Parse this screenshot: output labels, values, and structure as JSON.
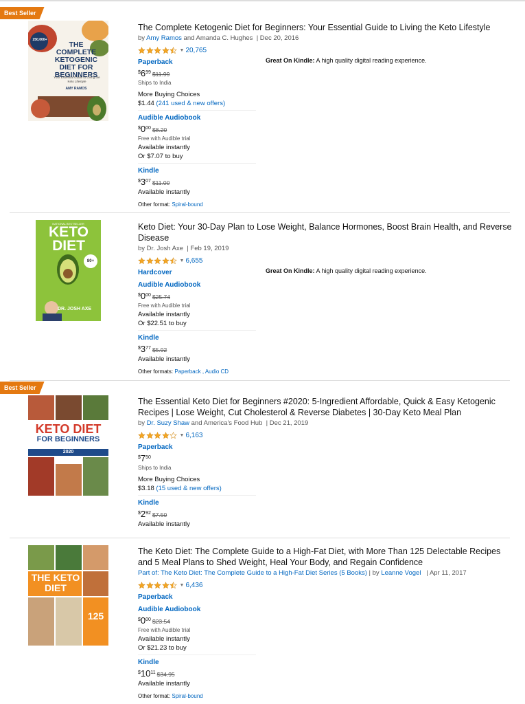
{
  "badge_label": "Best Seller",
  "kindle_note": {
    "label": "Great On Kindle:",
    "text": " A high quality digital reading experience."
  },
  "results": [
    {
      "title": "The Complete Ketogenic Diet for Beginners: Your Essential Guide to Living the Keto Lifestyle",
      "by": "by ",
      "author1": "Amy Ramos",
      "and": " and Amanda C. Hughes",
      "date": "|   Dec 20, 2016",
      "rating": 4.5,
      "reviews": "20,765",
      "cover": {
        "top_text": "250,000+",
        "title": "THE COMPLETE KETOGENIC DIET FOR BEGINNERS",
        "sub": "Your Essential Guide to Living the Keto Lifestyle",
        "author": "AMY RAMOS"
      },
      "formats": [
        {
          "name": "Paperback",
          "dollars": "6",
          "cents": "99",
          "list": "$11.99",
          "lines": [
            [
              "small",
              "Ships to India"
            ],
            [
              "gap",
              ""
            ],
            [
              "line",
              "More Buying Choices"
            ],
            [
              "offer",
              "$1.44",
              "(241 used & new offers)"
            ]
          ]
        },
        {
          "name": "Audible Audiobook",
          "dollars": "0",
          "cents": "00",
          "list": "$8.20",
          "lines": [
            [
              "small",
              "Free with Audible trial"
            ],
            [
              "line",
              "Available instantly"
            ],
            [
              "line",
              "Or $7.07 to buy"
            ]
          ]
        },
        {
          "name": "Kindle",
          "dollars": "3",
          "cents": "07",
          "list": "$11.00",
          "lines": [
            [
              "line",
              "Available instantly"
            ]
          ]
        }
      ],
      "other_label": "Other format: ",
      "other_links": "Spiral-bound"
    },
    {
      "title": "Keto Diet: Your 30-Day Plan to Lose Weight, Balance Hormones, Boost Brain Health, and Reverse Disease",
      "by": "by Dr. Josh Axe",
      "author1": "",
      "and": "",
      "date": "|   Feb 19, 2019",
      "rating": 4.5,
      "reviews": "6,655",
      "cover": {
        "top_text": "NATIONAL BESTSELLER",
        "title": "KETO DIET",
        "badge": "80+",
        "author": "DR. JOSH AXE"
      },
      "formats": [
        {
          "name": "Hardcover",
          "dollars": "",
          "cents": "",
          "list": "",
          "lines": []
        },
        {
          "name": "Audible Audiobook",
          "dollars": "0",
          "cents": "00",
          "list": "$25.74",
          "lines": [
            [
              "small",
              "Free with Audible trial"
            ],
            [
              "line",
              "Available instantly"
            ],
            [
              "line",
              "Or $22.51 to buy"
            ]
          ]
        },
        {
          "name": "Kindle",
          "dollars": "3",
          "cents": "77",
          "list": "$5.92",
          "lines": [
            [
              "line",
              "Available instantly"
            ]
          ]
        }
      ],
      "other_label": "Other formats: ",
      "other_links": "Paperback , Audio CD"
    },
    {
      "title": "The Essential Keto Diet for Beginners #2020: 5-Ingredient Affordable, Quick & Easy Ketogenic Recipes | Lose Weight, Cut Cholesterol & Reverse Diabetes | 30-Day Keto Meal Plan",
      "by": "by ",
      "author1": "Dr. Suzy Shaw",
      "and": " and America's Food Hub",
      "date": "|   Dec 21, 2019",
      "rating": 4,
      "reviews": "6,163",
      "cover": {
        "title": "KETO DIET",
        "sub": "FOR BEGINNERS",
        "year": "2020"
      },
      "formats": [
        {
          "name": "Paperback",
          "dollars": "7",
          "cents": "50",
          "list": "",
          "lines": [
            [
              "small",
              "Ships to India"
            ],
            [
              "gap",
              ""
            ],
            [
              "line",
              "More Buying Choices"
            ],
            [
              "offer",
              "$3.18",
              "(15 used & new offers)"
            ]
          ]
        },
        {
          "name": "Kindle",
          "dollars": "2",
          "cents": "92",
          "list": "$7.50",
          "lines": [
            [
              "line",
              "Available instantly"
            ]
          ]
        }
      ],
      "other_label": "",
      "other_links": ""
    },
    {
      "title": "The Keto Diet: The Complete Guide to a High-Fat Diet, with More Than 125 Delectable Recipes and 5 Meal Plans to Shed Weight, Heal Your Body, and Regain Confidence",
      "by": "",
      "series": "Part of: The Keto Diet: The Complete Guide to a High-Fat Diet Series (5 Books)",
      "by2": "  |   by ",
      "author1": "Leanne Vogel",
      "and": "",
      "date": "|   Apr 11, 2017",
      "rating": 4.5,
      "reviews": "6,436",
      "cover": {
        "title": "THE KETO DIET",
        "count": "125"
      },
      "formats": [
        {
          "name": "Paperback",
          "dollars": "",
          "cents": "",
          "list": "",
          "lines": []
        },
        {
          "name": "Audible Audiobook",
          "dollars": "0",
          "cents": "00",
          "list": "$23.54",
          "lines": [
            [
              "small",
              "Free with Audible trial"
            ],
            [
              "line",
              "Available instantly"
            ],
            [
              "line",
              "Or $21.23 to buy"
            ]
          ]
        },
        {
          "name": "Kindle",
          "dollars": "10",
          "cents": "11",
          "list": "$34.95",
          "lines": [
            [
              "line",
              "Available instantly"
            ]
          ]
        }
      ],
      "other_label": "Other format: ",
      "other_links": "Spiral-bound"
    }
  ]
}
